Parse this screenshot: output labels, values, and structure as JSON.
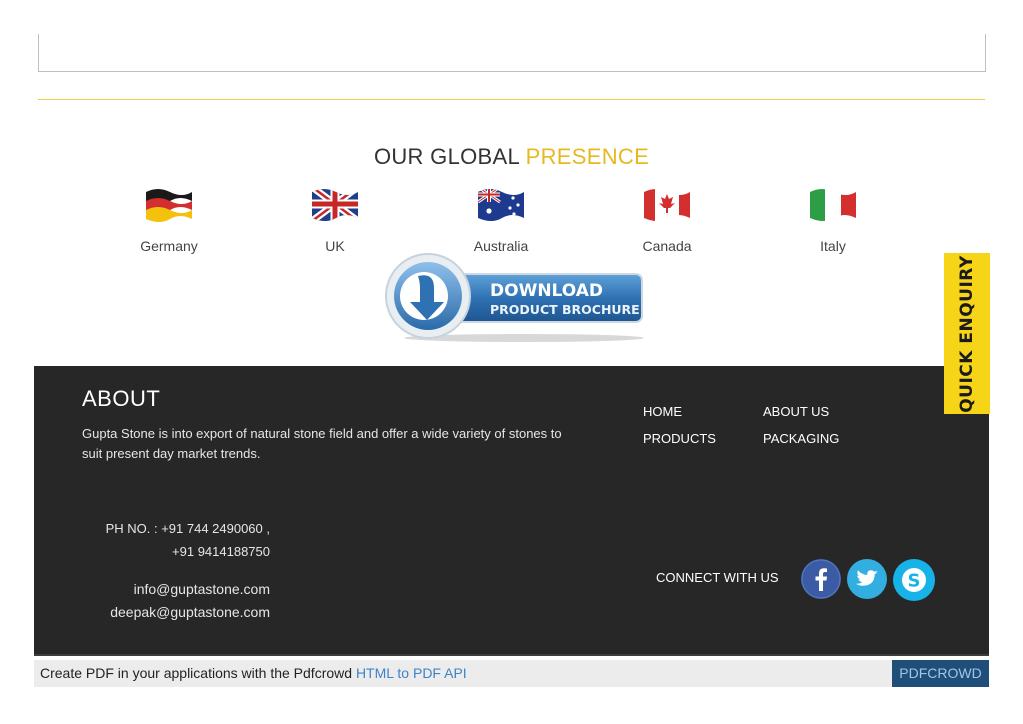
{
  "global": {
    "title_main": "OUR GLOBAL",
    "title_accent": "PRESENCE"
  },
  "countries": [
    {
      "name": "Germany",
      "flag": "germany-flag-icon"
    },
    {
      "name": "UK",
      "flag": "uk-flag-icon"
    },
    {
      "name": "Australia",
      "flag": "australia-flag-icon"
    },
    {
      "name": "Canada",
      "flag": "canada-flag-icon"
    },
    {
      "name": "Italy",
      "flag": "italy-flag-icon"
    }
  ],
  "download": {
    "line1": "DOWNLOAD",
    "line2": "PRODUCT BROCHURE"
  },
  "quick_enquiry": "QUICK ENQUIRY",
  "footer": {
    "about_title": "ABOUT",
    "about_text": "Gupta Stone is into export of natural stone field and offer a wide variety of stones to suit present day market trends.",
    "nav": [
      "HOME",
      "ABOUT US",
      "PRODUCTS",
      "PACKAGING"
    ],
    "phone_line1": "PH NO. : +91 744 2490060 ,",
    "phone_line2": "+91 9414188750",
    "email1": "info@guptastone.com",
    "email2": "deepak@guptastone.com",
    "connect_label": "CONNECT WITH US",
    "social": [
      "facebook-icon",
      "twitter-icon",
      "skype-icon"
    ]
  },
  "pdfcrowd": {
    "text": "Create PDF in your applications with the Pdfcrowd",
    "link": "HTML to PDF API",
    "badge": "PDFCROWD"
  },
  "colors": {
    "accent": "#e8b820",
    "footer_bg": "#272727",
    "quick_enquiry_bg": "#f6d417",
    "pdf_badge_bg": "#1f4e79",
    "link_blue": "#3d84c6"
  }
}
